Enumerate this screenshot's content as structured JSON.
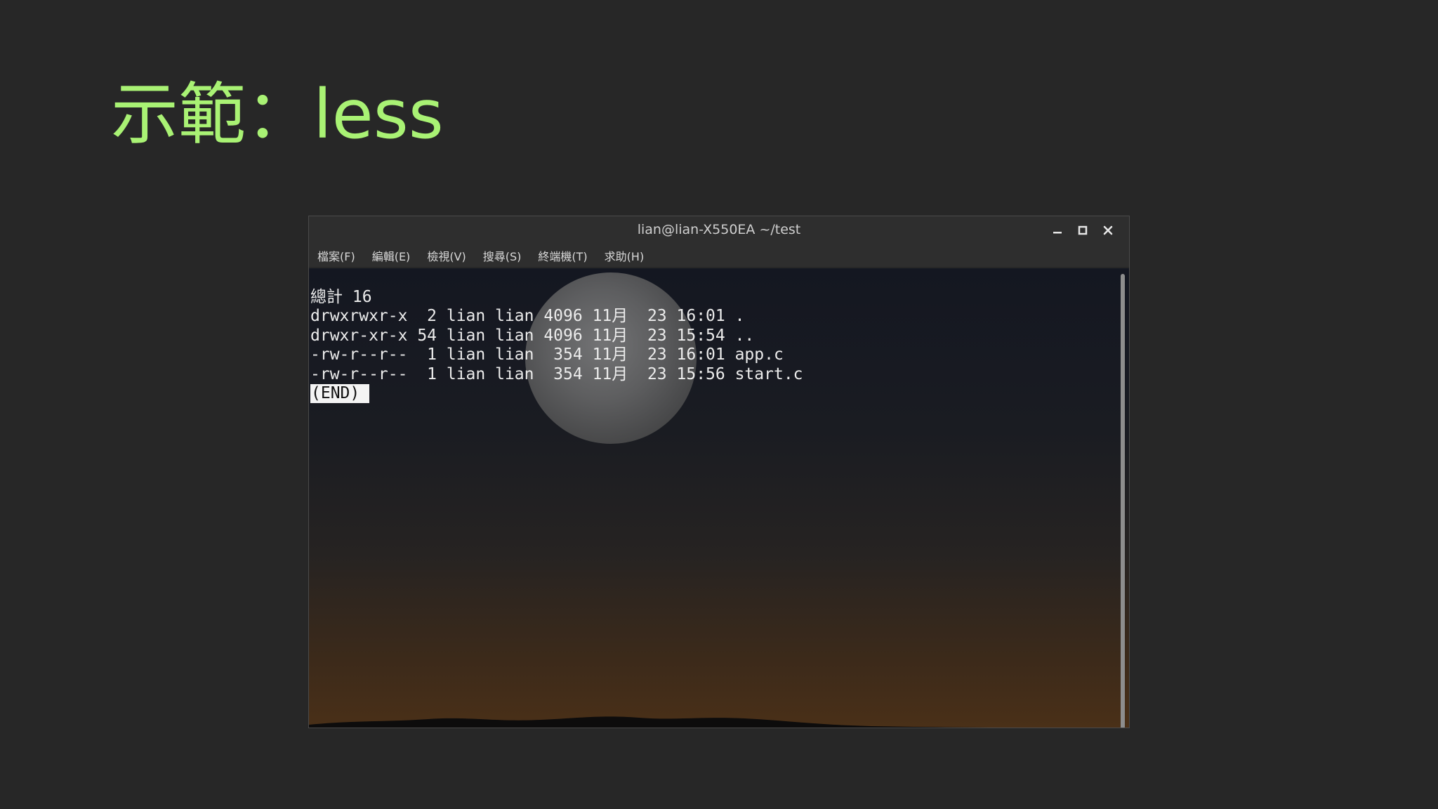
{
  "slide": {
    "title": "示範：less"
  },
  "window": {
    "title": "lian@lian-X550EA ~/test",
    "controls": {
      "minimize_icon": "minimize-icon",
      "maximize_icon": "maximize-icon",
      "close_icon": "close-icon"
    },
    "menu": [
      {
        "label": "檔案(F)"
      },
      {
        "label": "編輯(E)"
      },
      {
        "label": "檢視(V)"
      },
      {
        "label": "搜尋(S)"
      },
      {
        "label": "終端機(T)"
      },
      {
        "label": "求助(H)"
      }
    ]
  },
  "terminal": {
    "lines": [
      "總計 16",
      "drwxrwxr-x  2 lian lian 4096 11月  23 16:01 .",
      "drwxr-xr-x 54 lian lian 4096 11月  23 15:54 ..",
      "-rw-r--r--  1 lian lian  354 11月  23 16:01 app.c",
      "-rw-r--r--  1 lian lian  354 11月  23 15:56 start.c"
    ],
    "end_marker": "(END)"
  },
  "colors": {
    "title_green": "#a9f274",
    "slide_background": "#272727",
    "terminal_text": "#ececec"
  }
}
